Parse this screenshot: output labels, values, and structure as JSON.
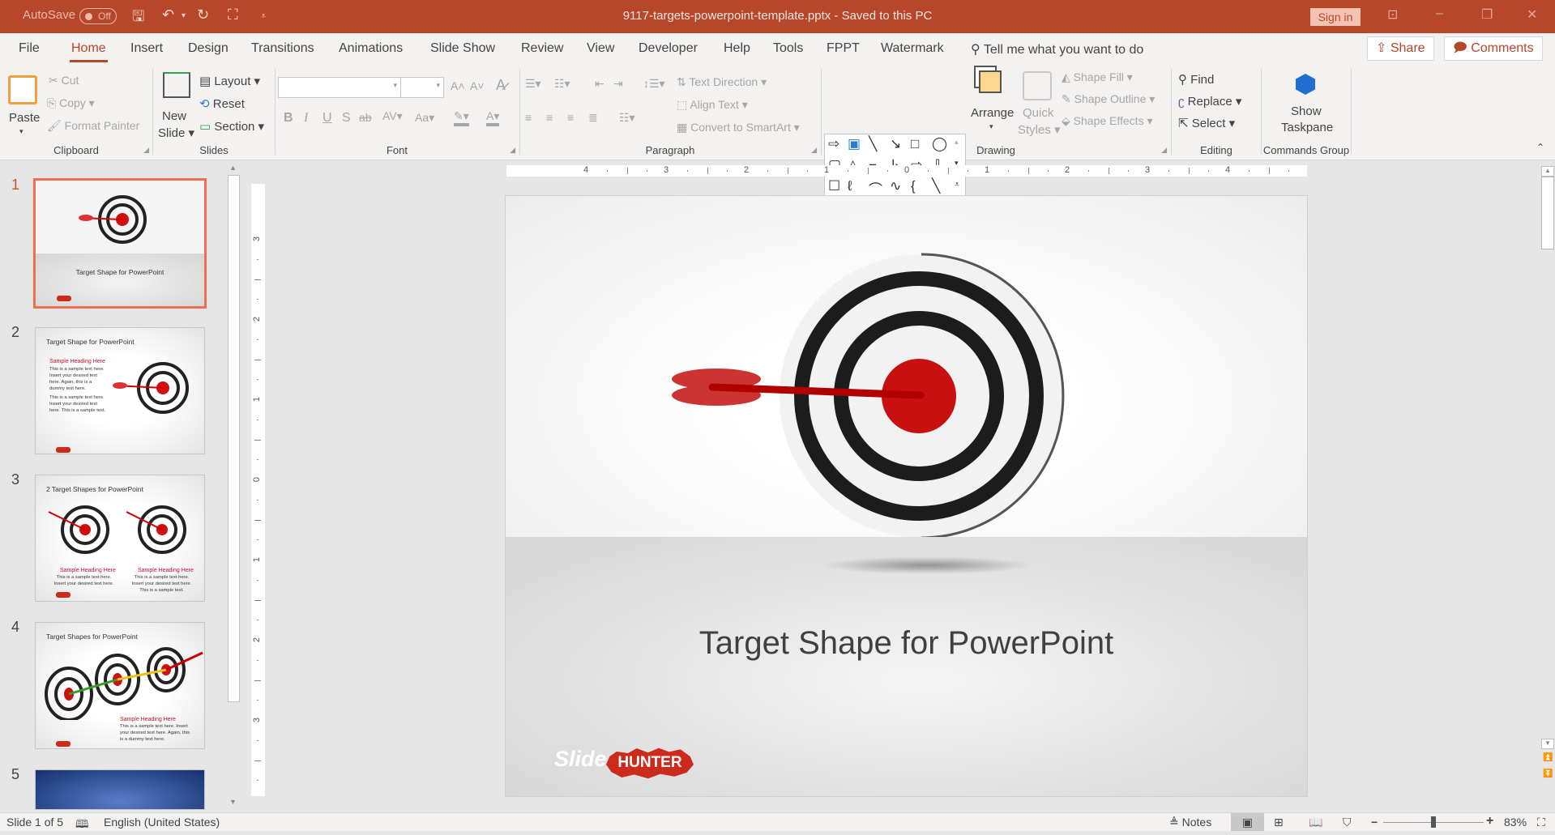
{
  "titlebar": {
    "autosave_label": "AutoSave",
    "autosave_state": "Off",
    "document_title": "9117-targets-powerpoint-template.pptx  -  Saved to this PC",
    "sign_in": "Sign in"
  },
  "menu": {
    "tabs": [
      "File",
      "Home",
      "Insert",
      "Design",
      "Transitions",
      "Animations",
      "Slide Show",
      "Review",
      "View",
      "Developer",
      "Help",
      "Tools",
      "FPPT",
      "Watermark"
    ],
    "active_tab": "Home",
    "tell_me": "Tell me what you want to do",
    "share": "Share",
    "comments": "Comments"
  },
  "ribbon": {
    "clipboard": {
      "label": "Clipboard",
      "paste": "Paste",
      "cut": "Cut",
      "copy": "Copy",
      "format_painter": "Format Painter"
    },
    "slides": {
      "label": "Slides",
      "new_slide_1": "New",
      "new_slide_2": "Slide",
      "layout": "Layout",
      "reset": "Reset",
      "section": "Section"
    },
    "font": {
      "label": "Font",
      "font_name": "",
      "font_size": ""
    },
    "paragraph": {
      "label": "Paragraph",
      "text_direction": "Text Direction",
      "align_text": "Align Text",
      "convert_smartart": "Convert to SmartArt"
    },
    "drawing": {
      "label": "Drawing",
      "arrange": "Arrange",
      "quick_1": "Quick",
      "quick_2": "Styles",
      "shape_fill": "Shape Fill",
      "shape_outline": "Shape Outline",
      "shape_effects": "Shape Effects"
    },
    "editing": {
      "label": "Editing",
      "find": "Find",
      "replace": "Replace",
      "select": "Select"
    },
    "commands": {
      "label": "Commands Group",
      "show_1": "Show",
      "show_2": "Taskpane"
    }
  },
  "thumbnails": [
    {
      "num": "1",
      "title": "Target Shape for PowerPoint",
      "selected": true
    },
    {
      "num": "2",
      "title": "Target Shape for PowerPoint",
      "heading": "Sample Heading Here",
      "text1": "This is a sample text here. Insert your desired text here. Again, this is a dummy text here.",
      "text2": "This is a sample text here. Insert your desired text here. This is a sample text."
    },
    {
      "num": "3",
      "title": "2 Target Shapes for PowerPoint",
      "heading_left": "Sample Heading Here",
      "text_left": "This is a sample text here. Insert your desired text here.",
      "heading_right": "Sample Heading Here",
      "text_right": "This is a sample text here. Insert your desired text here. This is a sample text."
    },
    {
      "num": "4",
      "title": "Target Shapes for PowerPoint",
      "heading": "Sample Heading Here",
      "text": "This is a sample text here. Insert your desired text here. Again, this is a dummy text here."
    },
    {
      "num": "5"
    }
  ],
  "ruler": {
    "h_labels": [
      "4",
      "3",
      "2",
      "1",
      "0",
      "1",
      "2",
      "3",
      "4"
    ],
    "v_labels": [
      "3",
      "2",
      "1",
      "0",
      "1",
      "2",
      "3"
    ]
  },
  "slide": {
    "title": "Target Shape for PowerPoint",
    "logo_slide": "Slide",
    "logo_hunter": "HUNTER"
  },
  "status": {
    "slide_info": "Slide 1 of 5",
    "language": "English (United States)",
    "notes": "Notes",
    "zoom": "83%",
    "zoom_fraction": 0.5
  }
}
